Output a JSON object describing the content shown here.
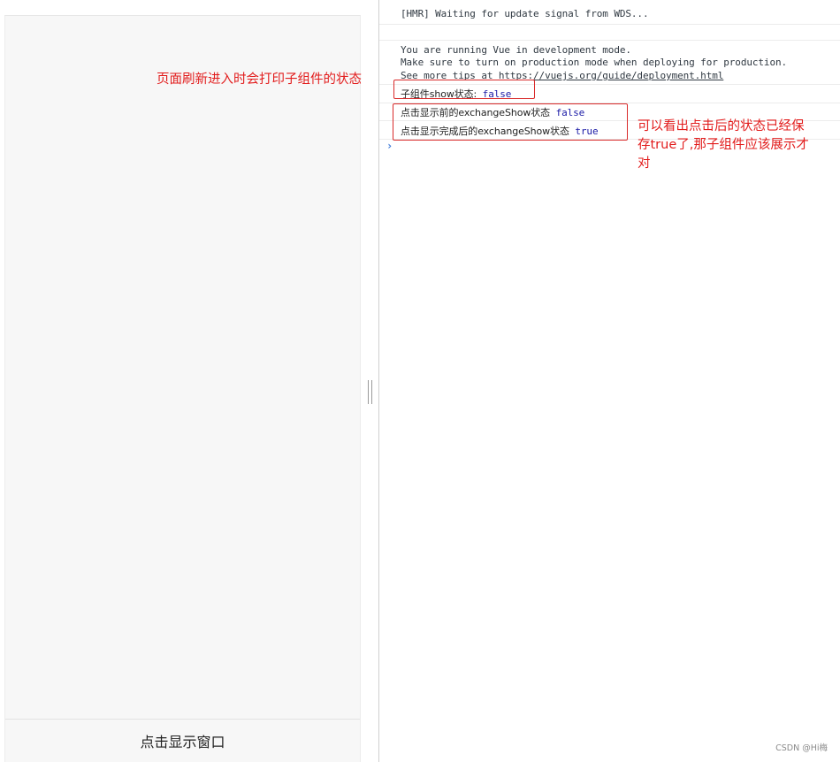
{
  "app": {
    "footer_button_label": "点击显示窗口"
  },
  "console": {
    "hmr_line": "[HMR] Waiting for update signal from WDS...",
    "vue_line1": "You are running Vue in development mode.",
    "vue_line2": "Make sure to turn on production mode when deploying for production.",
    "vue_line3_prefix": "See more tips at ",
    "vue_line3_link": "https://vuejs.org/guide/deployment.html",
    "log1_label": "子组件show状态:",
    "log1_value": "false",
    "log2_label": "点击显示前的exchangeShow状态",
    "log2_value": "false",
    "log3_label": "点击显示完成后的exchangeShow状态",
    "log3_value": "true",
    "prompt_symbol": "›"
  },
  "annotations": {
    "refresh_note": "页面刷新进入时会打印子组件的状态",
    "state_note_line1": "可以看出点击后的状态已经保",
    "state_note_line2": "存true了,那子组件应该展示才",
    "state_note_line3": "对"
  },
  "watermark": "CSDN @Hi梅",
  "colors": {
    "annotation_red": "#e21c1c",
    "boolean_blue": "#1a1aa6",
    "prompt_blue": "#3d7ad8"
  }
}
